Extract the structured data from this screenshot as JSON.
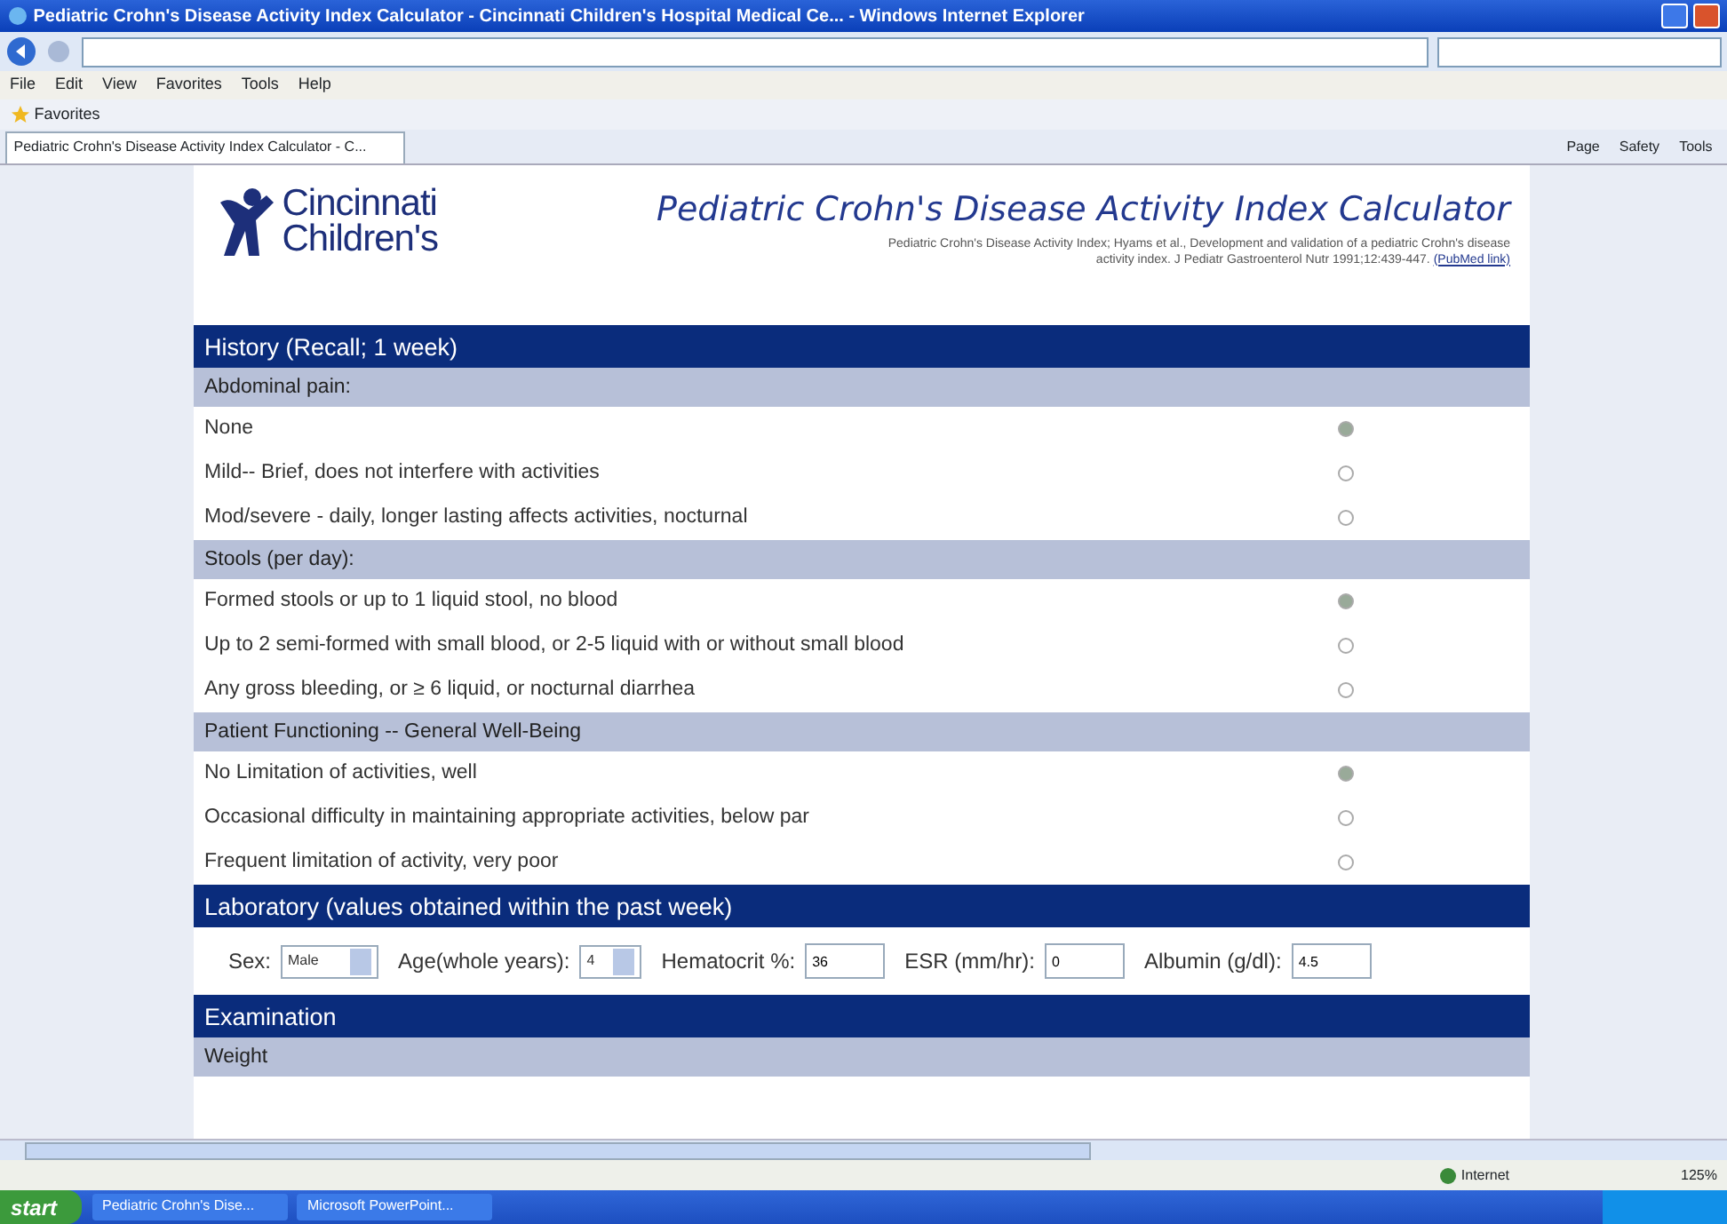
{
  "window": {
    "title": "Pediatric Crohn's Disease Activity Index Calculator - Cincinnati Children's Hospital Medical Ce... - Windows Internet Explorer"
  },
  "menu": [
    "File",
    "Edit",
    "View",
    "Favorites",
    "Tools",
    "Help"
  ],
  "favorites_bar": {
    "label": "Favorites"
  },
  "tab": {
    "title": "Pediatric Crohn's Disease Activity Index Calculator - C..."
  },
  "command_bar": [
    "Page",
    "Safety",
    "Tools"
  ],
  "page": {
    "logo": [
      "Cincinnati",
      "Children's"
    ],
    "title": "Pediatric Crohn's Disease Activity Index Calculator",
    "citation": "Pediatric Crohn's Disease Activity Index; Hyams et al., Development and validation of a pediatric Crohn's disease activity index. J Pediatr Gastroenterol Nutr 1991;12:439-447.",
    "citation_link": "(PubMed link)",
    "history": {
      "title": "History (Recall; 1 week)",
      "groups": [
        {
          "label": "Abdominal pain:",
          "options": [
            {
              "text": "None",
              "selected": true
            },
            {
              "text": "Mild-- Brief, does not interfere with activities",
              "selected": false
            },
            {
              "text": "Mod/severe - daily, longer lasting affects activities, nocturnal",
              "selected": false
            }
          ]
        },
        {
          "label": "Stools (per day):",
          "options": [
            {
              "text": "Formed stools or up to 1 liquid stool, no blood",
              "selected": true
            },
            {
              "text": "Up to 2 semi-formed with small blood, or 2-5 liquid with or without small blood",
              "selected": false
            },
            {
              "text": "Any gross bleeding, or ≥ 6 liquid, or nocturnal diarrhea",
              "selected": false
            }
          ]
        },
        {
          "label": "Patient Functioning -- General Well-Being",
          "options": [
            {
              "text": "No Limitation of activities, well",
              "selected": true
            },
            {
              "text": "Occasional difficulty in maintaining appropriate activities, below par",
              "selected": false
            },
            {
              "text": "Frequent limitation of activity, very poor",
              "selected": false
            }
          ]
        }
      ]
    },
    "laboratory": {
      "title": "Laboratory (values obtained within the past week)",
      "fields": [
        {
          "kind": "select",
          "label": "Sex:",
          "value": "Male"
        },
        {
          "kind": "select",
          "label": "Age(whole years):",
          "value": "4"
        },
        {
          "kind": "input",
          "label": "Hematocrit %:",
          "value": "36"
        },
        {
          "kind": "input",
          "label": "ESR (mm/hr):",
          "value": "0"
        },
        {
          "kind": "input",
          "label": "Albumin (g/dl):",
          "value": "4.5"
        }
      ]
    },
    "examination": {
      "title": "Examination",
      "groups": [
        {
          "label": "Weight"
        }
      ]
    }
  },
  "status_bar": {
    "zone": "Internet",
    "zoom": "125%"
  },
  "taskbar": {
    "start": "start",
    "buttons": [
      "Pediatric Crohn's Dise...",
      "Microsoft PowerPoint..."
    ]
  }
}
